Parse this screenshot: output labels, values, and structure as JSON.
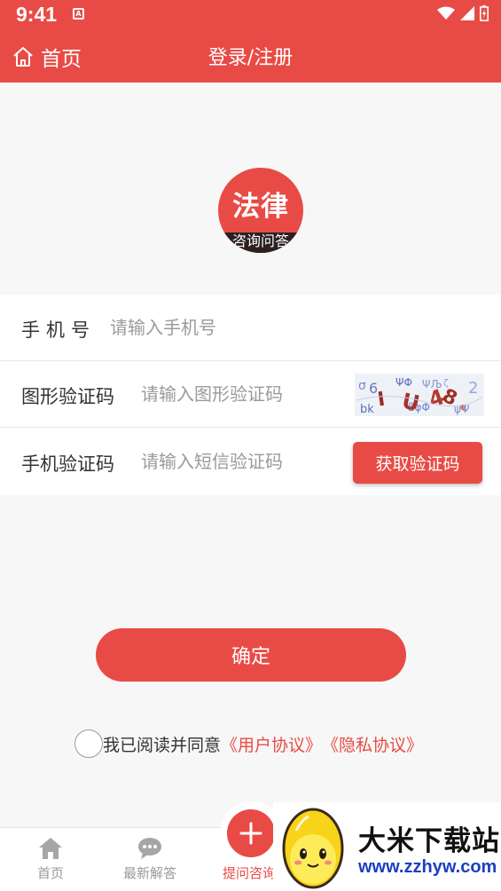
{
  "status_bar": {
    "time": "9:41",
    "notification_badge": "A"
  },
  "nav": {
    "home_label": "首页",
    "title": "登录/注册"
  },
  "logo": {
    "main_text": "法律",
    "sub_text": "咨询问答"
  },
  "form": {
    "phone": {
      "label": "手机号",
      "placeholder": "请输入手机号",
      "value": ""
    },
    "captcha": {
      "label": "图形验证码",
      "placeholder": "请输入图形验证码",
      "value": ""
    },
    "sms": {
      "label": "手机验证码",
      "placeholder": "请输入短信验证码",
      "value": "",
      "button_label": "获取验证码"
    }
  },
  "confirm_label": "确定",
  "agreement": {
    "prefix": "我已阅读并同意",
    "user_agreement": "《用户协议》",
    "privacy_agreement": "《隐私协议》",
    "checked": false
  },
  "tabs": [
    {
      "label": "首页",
      "icon": "house-icon"
    },
    {
      "label": "最新解答",
      "icon": "chat-bubble-icon"
    },
    {
      "label": "提问咨询",
      "icon": "plus-icon"
    }
  ],
  "watermark": {
    "title": "大米下载站",
    "url": "www.zzhyw.com"
  },
  "colors": {
    "primary": "#e84b45",
    "link": "#e84b45",
    "watermark_url": "#1b3fbf"
  }
}
